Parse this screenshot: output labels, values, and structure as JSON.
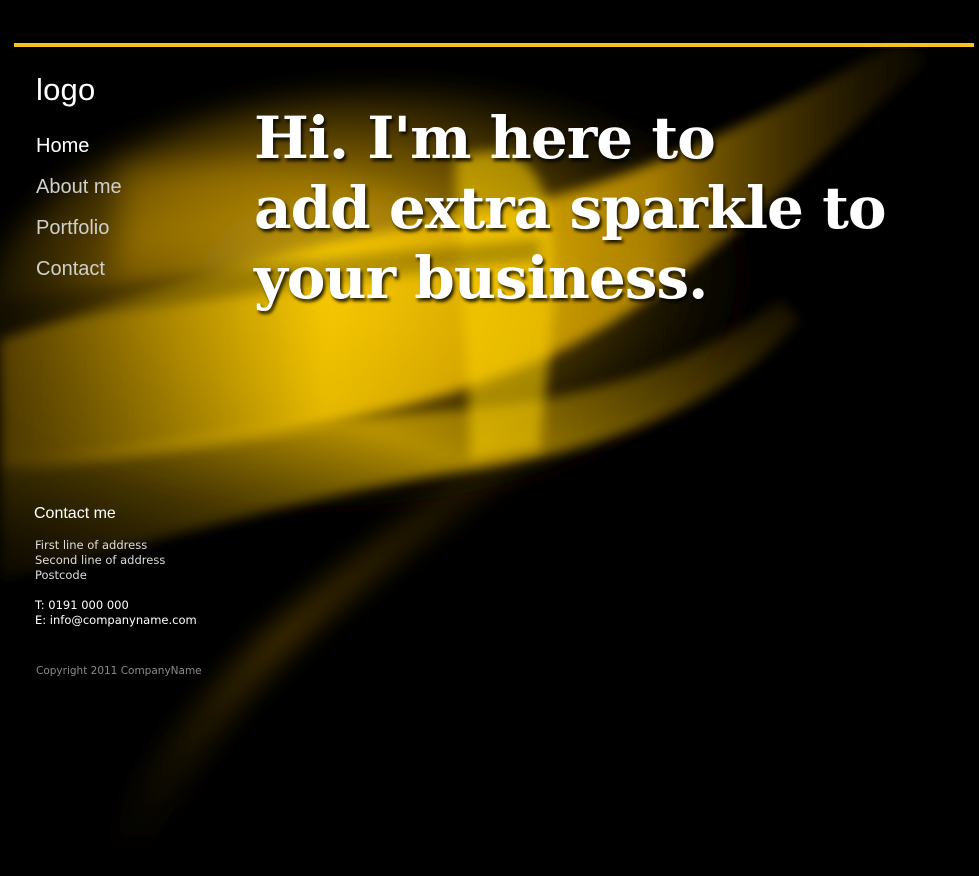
{
  "colors": {
    "background": "#000000",
    "accent": "#f5c21e",
    "swirl": "#e8b800"
  },
  "logo": "logo",
  "nav": {
    "items": [
      {
        "label": "Home",
        "active": true
      },
      {
        "label": "About me",
        "active": false
      },
      {
        "label": "Portfolio",
        "active": false
      },
      {
        "label": "Contact",
        "active": false
      }
    ]
  },
  "hero": {
    "lines": [
      "Hi. I'm here to",
      "add extra sparkle to",
      "your business."
    ]
  },
  "contact": {
    "title": "Contact me",
    "address": [
      "First line of address",
      "Second line of address",
      "Postcode"
    ],
    "phone": "T: 0191 000 000",
    "email": "E: info@companyname.com"
  },
  "footer": {
    "copyright": "Copyright 2011 CompanyName"
  }
}
